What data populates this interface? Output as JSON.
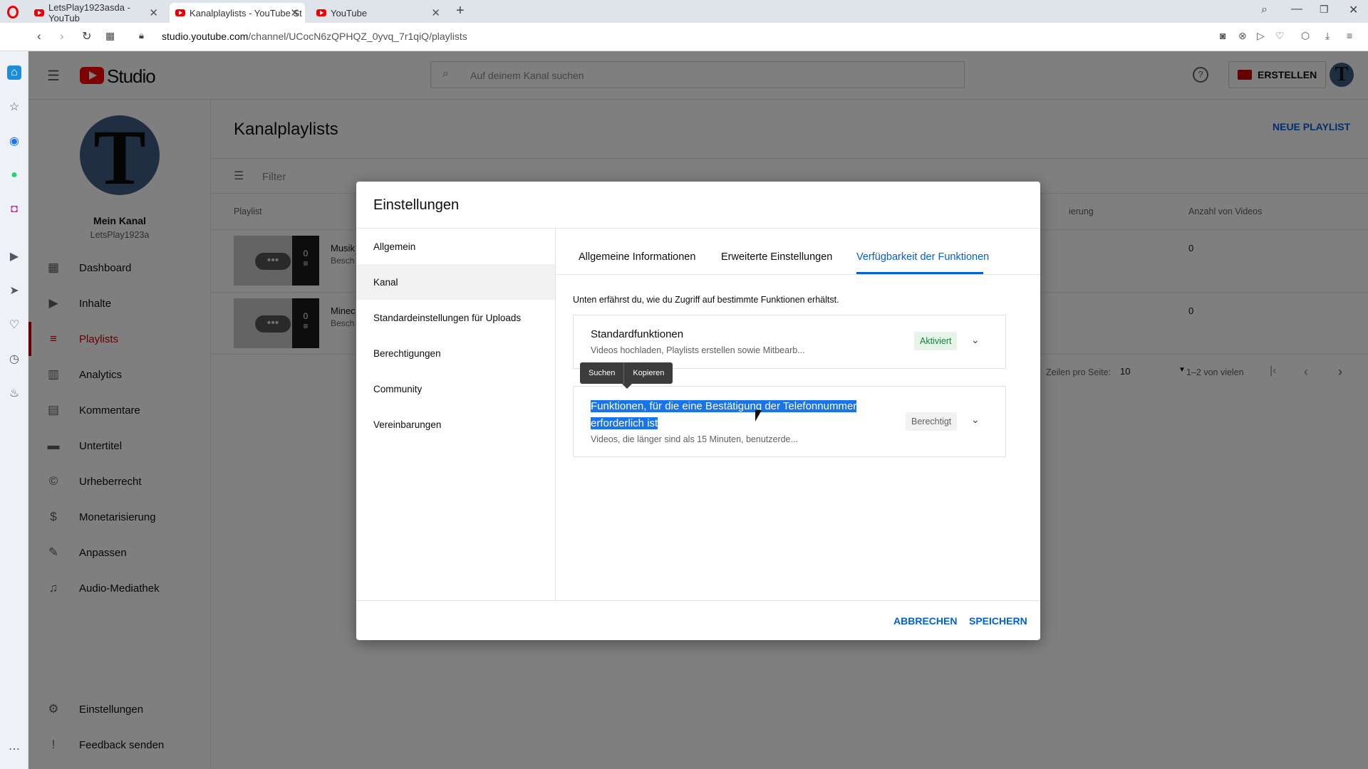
{
  "browser": {
    "tabs": [
      {
        "label": "LetsPlay1923asda - YouTub"
      },
      {
        "label": "Kanalplaylists - YouTube St"
      },
      {
        "label": "YouTube"
      }
    ],
    "url_host": "studio.youtube.com",
    "url_path": "/channel/UCocN6zQPHQZ_0yvq_7r1qiQ/playlists"
  },
  "header": {
    "logo_text": "Studio",
    "search_placeholder": "Auf deinem Kanal suchen",
    "create_label": "ERSTELLEN",
    "avatar_letter": "T"
  },
  "channel": {
    "avatar_letter": "T",
    "name": "Mein Kanal",
    "handle": "LetsPlay1923a"
  },
  "nav": {
    "items": [
      {
        "label": "Dashboard",
        "icon": "dashboard-icon"
      },
      {
        "label": "Inhalte",
        "icon": "content-icon"
      },
      {
        "label": "Playlists",
        "icon": "playlist-icon"
      },
      {
        "label": "Analytics",
        "icon": "analytics-icon"
      },
      {
        "label": "Kommentare",
        "icon": "comments-icon"
      },
      {
        "label": "Untertitel",
        "icon": "subtitles-icon"
      },
      {
        "label": "Urheberrecht",
        "icon": "copyright-icon"
      },
      {
        "label": "Monetarisierung",
        "icon": "dollar-icon"
      },
      {
        "label": "Anpassen",
        "icon": "customize-icon"
      },
      {
        "label": "Audio-Mediathek",
        "icon": "audio-library-icon"
      }
    ],
    "settings_label": "Einstellungen",
    "feedback_label": "Feedback senden",
    "selected": "Playlists"
  },
  "main": {
    "title": "Kanalplaylists",
    "new_playlist_label": "NEUE PLAYLIST",
    "filter_label": "Filter",
    "col_playlist": "Playlist",
    "col_visibility_partial": "ierung",
    "col_count": "Anzahl von Videos",
    "rows": [
      {
        "title": "Musik",
        "desc": "Besch",
        "videos_overlay": "0",
        "count": "0"
      },
      {
        "title": "Minec",
        "desc": "Besch",
        "videos_overlay": "0",
        "count": "0"
      }
    ],
    "rows_per_page_label": "Zeilen pro Seite:",
    "rows_per_page_value": "10",
    "range_label": "1–2 von vielen"
  },
  "dialog": {
    "title": "Einstellungen",
    "left_items": [
      "Allgemein",
      "Kanal",
      "Standardeinstellungen für Uploads",
      "Berechtigungen",
      "Community",
      "Vereinbarungen"
    ],
    "selected_left": "Kanal",
    "tabs": [
      "Allgemeine Informationen",
      "Erweiterte Einstellungen",
      "Verfügbarkeit der Funktionen"
    ],
    "selected_tab": "Verfügbarkeit der Funktionen",
    "intro": "Unten erfährst du, wie du Zugriff auf bestimmte Funktionen erhältst.",
    "cards": [
      {
        "title": "Standardfunktionen",
        "subtitle": "Videos hochladen, Playlists erstellen sowie Mitbearb...",
        "badge": "Aktiviert"
      },
      {
        "title_line1": "Funktionen, für die eine Bestätigung der Telefonnummer",
        "title_line2": "erforderlich ist",
        "subtitle": "Videos, die länger sind als 15 Minuten, benutzerde...",
        "badge": "Berechtigt"
      }
    ],
    "context_menu": [
      "Suchen",
      "Kopieren"
    ],
    "cancel_label": "ABBRECHEN",
    "save_label": "SPEICHERN"
  },
  "colors": {
    "accent_blue": "#065fd4",
    "youtube_red": "#ff0000",
    "selected_nav": "#cc0000",
    "badge_green_bg": "#e6f4ea",
    "badge_green_text": "#188038",
    "selection": "#1a73e8"
  }
}
